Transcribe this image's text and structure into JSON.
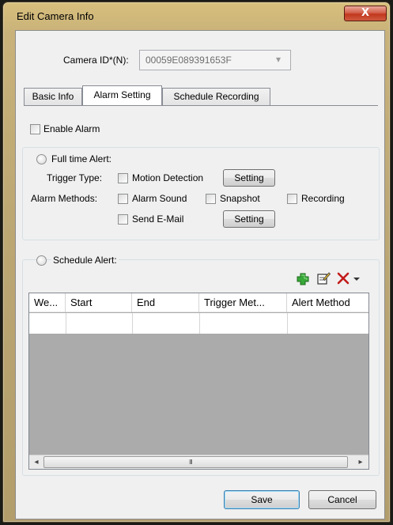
{
  "window": {
    "title": "Edit Camera Info",
    "close_glyph": "X"
  },
  "camera_id": {
    "label": "Camera ID*(N):",
    "value": "00059E089391653F",
    "dropdown_glyph": "▾"
  },
  "tabs": [
    {
      "label": "Basic Info"
    },
    {
      "label": "Alarm Setting"
    },
    {
      "label": "Schedule Recording"
    }
  ],
  "alarm": {
    "enable_label": "Enable Alarm",
    "full_time_label": "Full time Alert:",
    "trigger_type_label": "Trigger Type:",
    "motion_detection_label": "Motion Detection",
    "setting_button_1": "Setting",
    "alarm_methods_label": "Alarm Methods:",
    "alarm_sound_label": "Alarm Sound",
    "snapshot_label": "Snapshot",
    "recording_label": "Recording",
    "send_email_label": "Send E-Mail",
    "setting_button_2": "Setting",
    "schedule_alert_label": "Schedule Alert:"
  },
  "icons": [
    "add-icon",
    "edit-icon",
    "delete-icon",
    "dropdown-arrow-icon"
  ],
  "table": {
    "columns": [
      "We...",
      "Start",
      "End",
      "Trigger Met...",
      "Alert Method"
    ]
  },
  "scrollbar": {
    "left_arrow": "◂",
    "right_arrow": "▸",
    "grip": "III"
  },
  "footer": {
    "save_label": "Save",
    "cancel_label": "Cancel"
  },
  "colors": {
    "frame": "#c6b078",
    "close_button": "#c8432a",
    "add_icon": "#2e9a2e",
    "delete_icon": "#c21a1a",
    "table_empty_area": "#ababab"
  }
}
